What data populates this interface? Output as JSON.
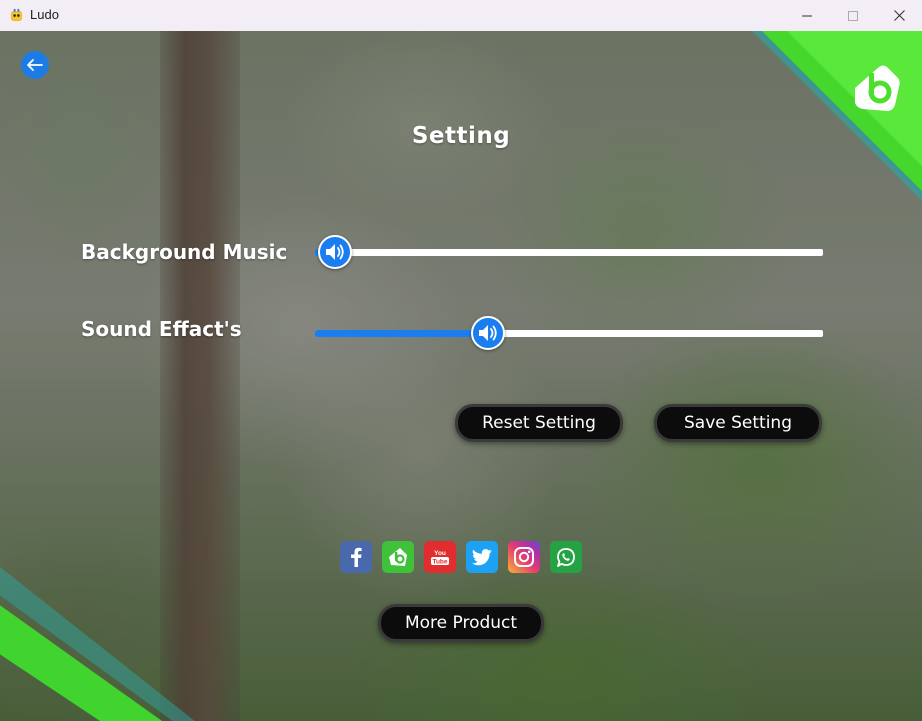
{
  "window": {
    "title": "Ludo",
    "controls": [
      "minimize",
      "maximize",
      "close"
    ]
  },
  "header": {
    "back_icon": "arrow-left-icon",
    "title": "Setting",
    "brand_logo": "bubble-b-logo"
  },
  "settings": [
    {
      "label": "Background Music",
      "level": 0.04,
      "icon": "speaker-icon"
    },
    {
      "label": "Sound Effact's",
      "level": 0.34,
      "icon": "speaker-icon"
    }
  ],
  "actions": {
    "reset_label": "Reset Setting",
    "save_label": "Save Setting"
  },
  "social": [
    {
      "name": "facebook",
      "color": "#4a69ad"
    },
    {
      "name": "bubble-app",
      "color": "#3fc13a"
    },
    {
      "name": "youtube",
      "color": "#e12d2d"
    },
    {
      "name": "twitter",
      "color": "#1da1f2"
    },
    {
      "name": "instagram",
      "color": "#c13584"
    },
    {
      "name": "whatsapp",
      "color": "#25a243"
    }
  ],
  "more_product_label": "More Product",
  "colors": {
    "accent_blue": "#1a7ef0",
    "brand_green": "#4ddf2e",
    "button_bg": "#0c0c0c"
  }
}
